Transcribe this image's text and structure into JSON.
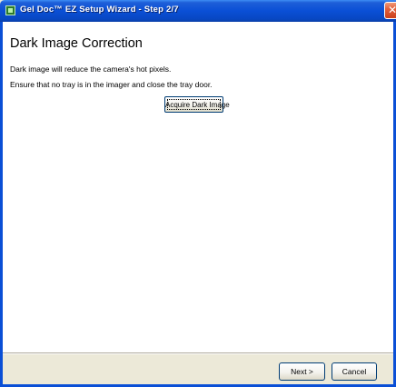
{
  "window": {
    "title": "Gel Doc™ EZ Setup Wizard - Step 2/7",
    "close_glyph": "✕"
  },
  "page": {
    "heading": "Dark Image Correction",
    "description_line1": "Dark image will reduce the camera's hot pixels.",
    "description_line2": "Ensure that no tray is in the imager and close the tray door."
  },
  "buttons": {
    "acquire_label": "Acquire Dark Image",
    "next_label": "Next >",
    "cancel_label": "Cancel"
  },
  "icons": {
    "app_icon": "gel-doc-app-icon",
    "close_icon": "close-icon"
  },
  "colors": {
    "titlebar": "#0A4FD6",
    "close_button": "#E2603C",
    "dialog_face": "#ECE9D8",
    "content_bg": "#FFFFFF",
    "button_border": "#003C74"
  }
}
